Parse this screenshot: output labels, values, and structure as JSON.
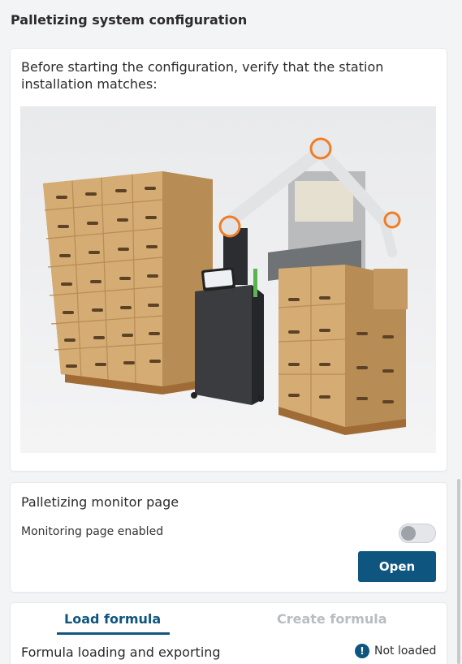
{
  "page": {
    "title": "Palletizing system configuration"
  },
  "installation": {
    "text": "Before starting the configuration, verify that the station installation matches:"
  },
  "monitor": {
    "title": "Palletizing monitor page",
    "toggle_label": "Monitoring page enabled",
    "toggle_on": false,
    "open_label": "Open"
  },
  "formula": {
    "tabs": [
      {
        "label": "Load formula",
        "active": true
      },
      {
        "label": "Create formula",
        "active": false
      }
    ],
    "label": "Formula loading and exporting",
    "status": "Not loaded",
    "status_icon": "!"
  },
  "colors": {
    "accent": "#0e5680",
    "inactive_tab": "#b9bcc1",
    "background": "#f3f4f6"
  }
}
